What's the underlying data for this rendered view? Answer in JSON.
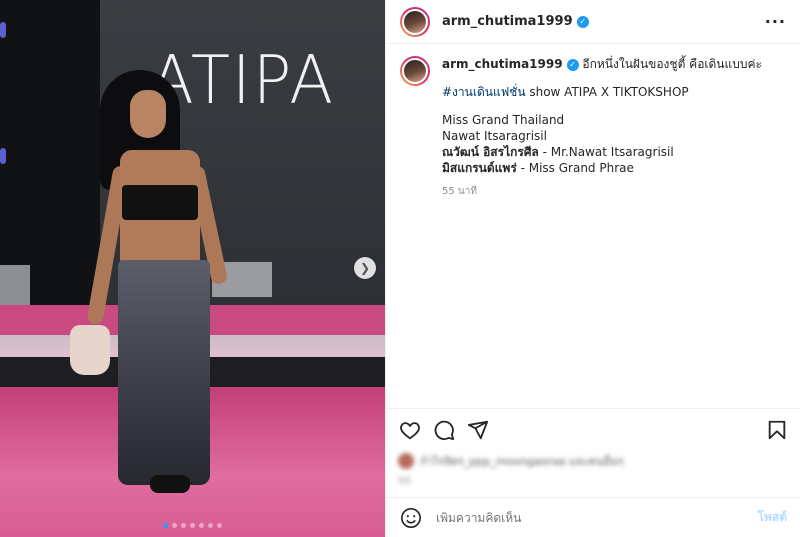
{
  "photo": {
    "brand_text": "ATIPA",
    "carousel_total": 7,
    "carousel_active": 1,
    "next_icon": "chevron-right-icon"
  },
  "header": {
    "username": "arm_chutima1999",
    "verified": true,
    "more_icon": "more-horizontal-icon"
  },
  "caption": {
    "username": "arm_chutima1999",
    "text": "อีกหนึ่งในฝันของชูตี้ คือเดินแบบค่ะ",
    "hashtag": "#งานเดินแฟชั่น",
    "hashtag_rest": " show ATIPA X TIKTOKSHOP",
    "line1": "Miss Grand Thailand",
    "line2": "Nawat Itsaragrisil",
    "line3_bold": "ณวัฒน์ อิสรไกรศีล",
    "line3_rest": " - Mr.Nawat Itsaragrisil",
    "line4_bold": "มิสแกรนด์แพร่",
    "line4_rest": " - Miss Grand Phrae",
    "time": "55 นาที"
  },
  "actions": {
    "like_icon": "heart-icon",
    "comment_icon": "comment-icon",
    "share_icon": "share-icon",
    "save_icon": "bookmark-icon"
  },
  "likes": {
    "blurred_text": "กำไรจิตร_ppp_moongaoraa และคนอื่นๆ",
    "blurred_count": "55"
  },
  "comment": {
    "placeholder": "เพิ่มความคิดเห็น",
    "post_label": "โพสต์"
  },
  "colors": {
    "verified": "#1d9bf0",
    "hashtag": "#00376b",
    "post_disabled": "#b2dffc"
  }
}
